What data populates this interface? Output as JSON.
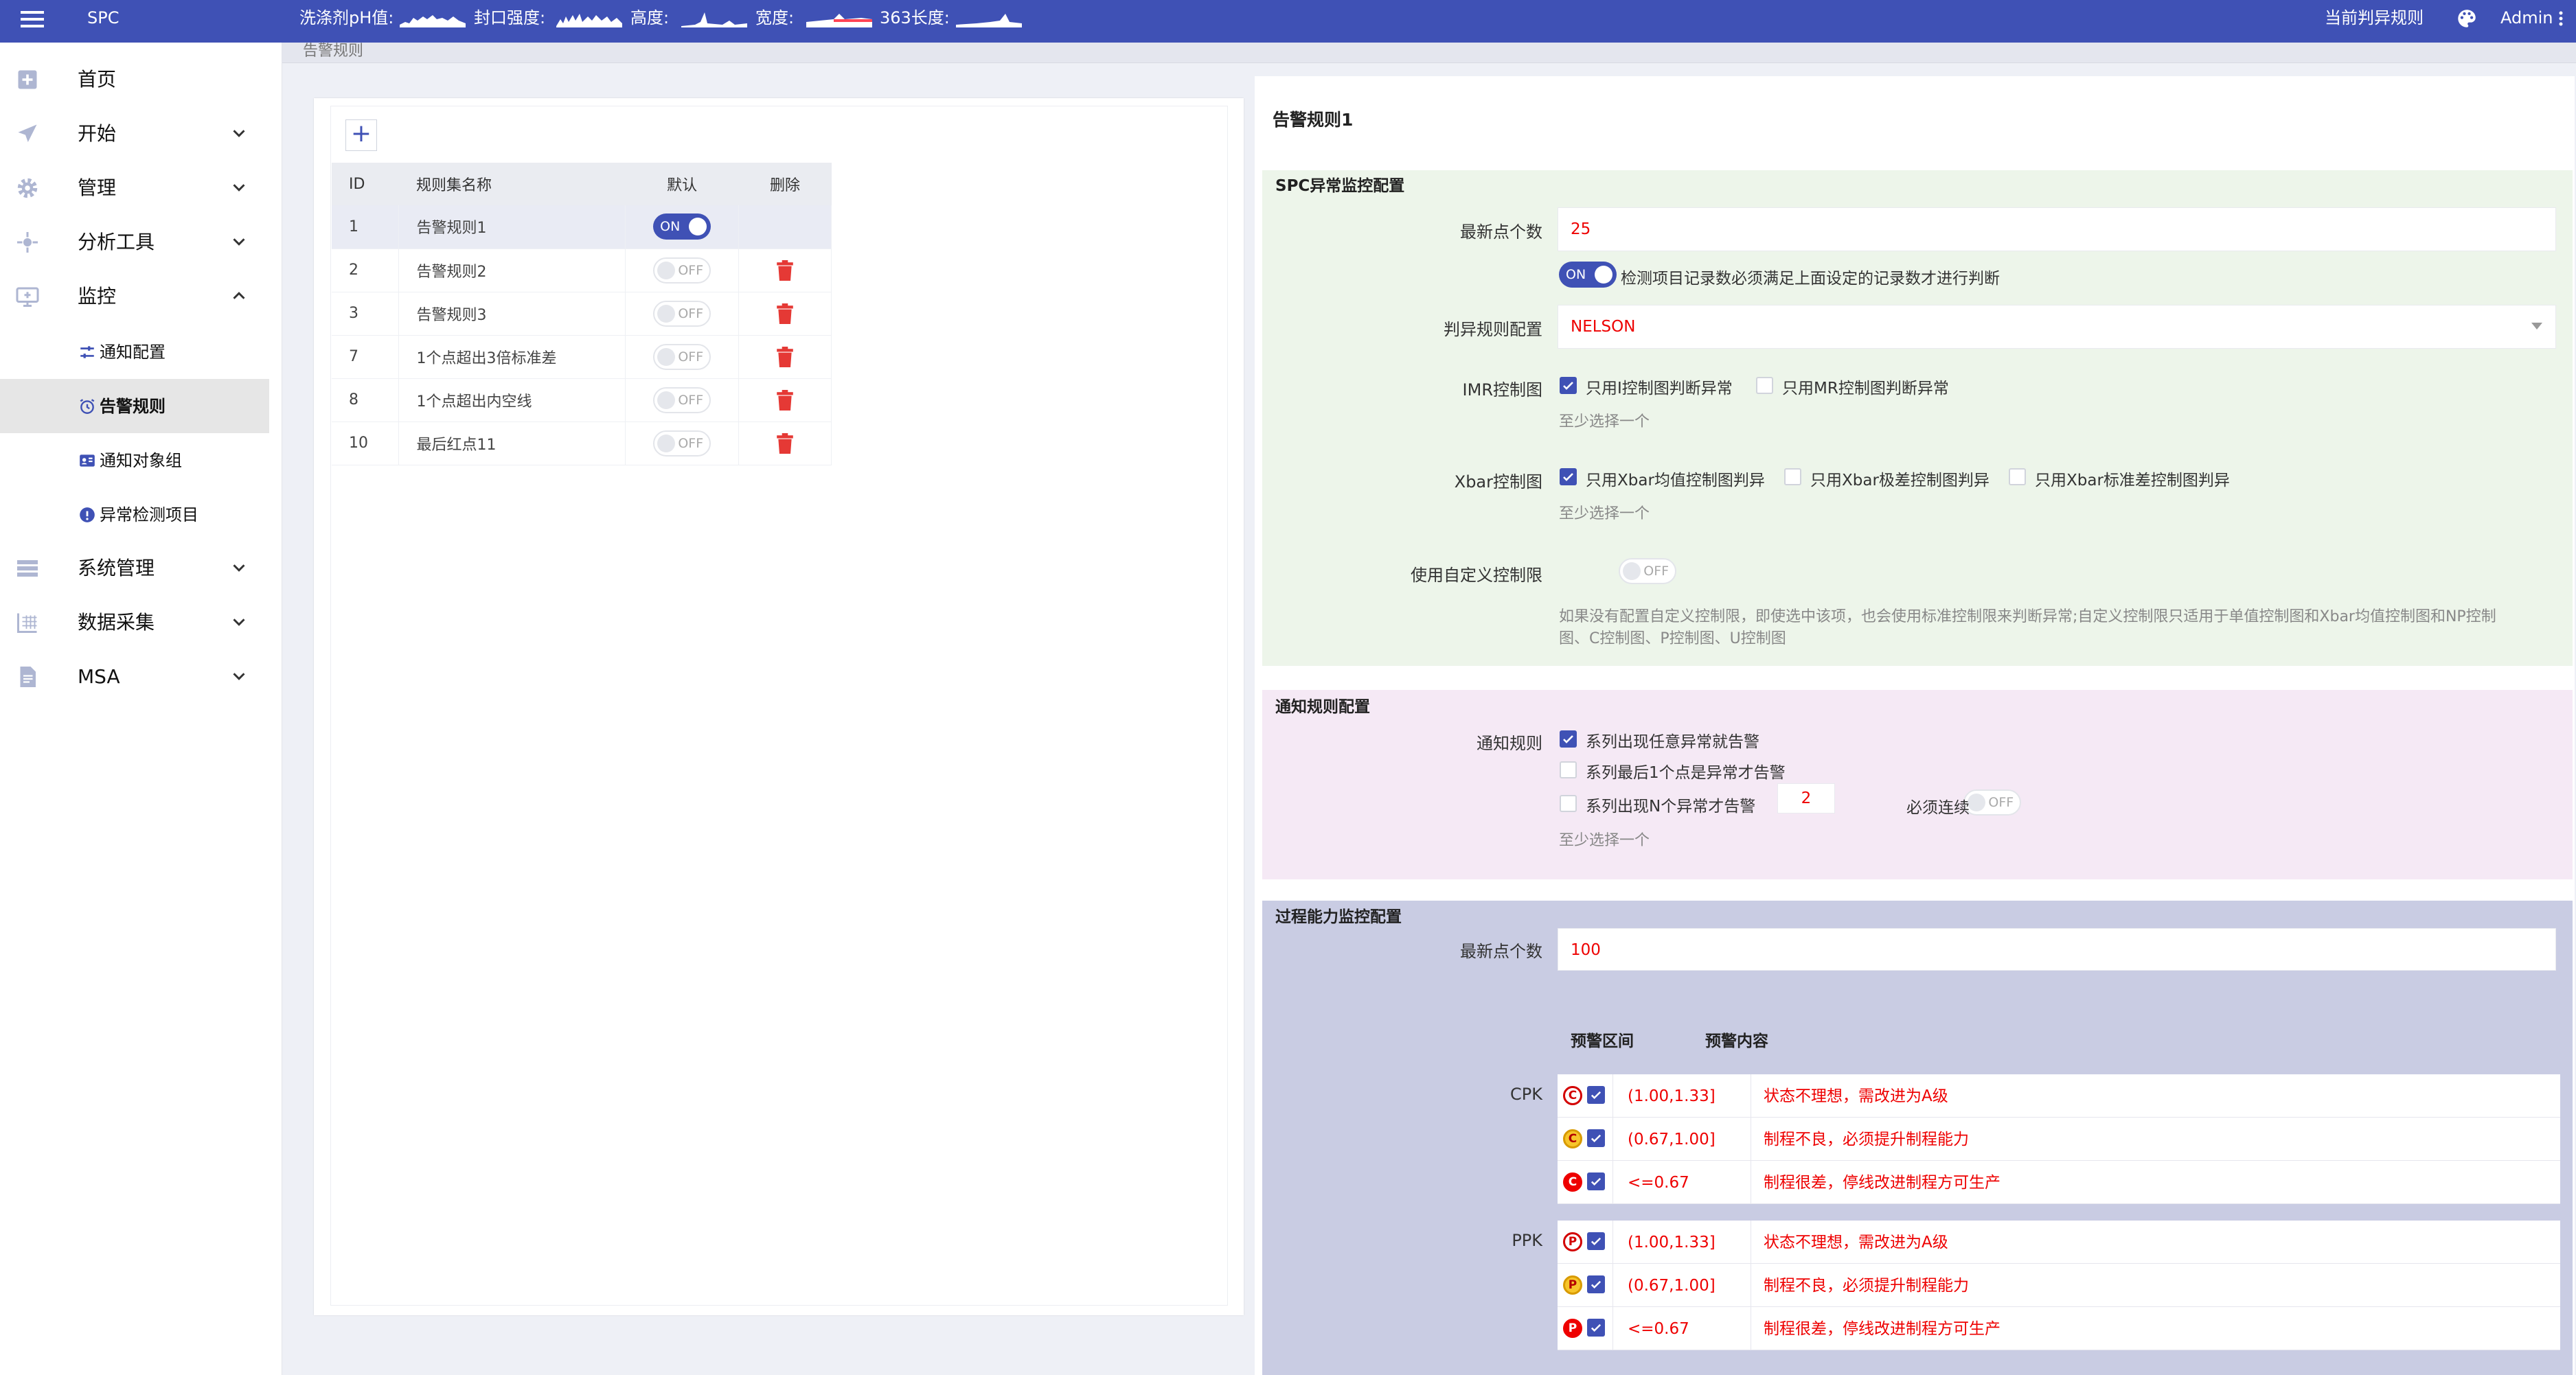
{
  "topbar": {
    "app_title": "SPC",
    "metrics": [
      "洗涤剂pH值:",
      "封口强度:",
      "高度:",
      "宽度:",
      "363长度:"
    ],
    "current_rule_link": "当前判异规则",
    "user": "Admin"
  },
  "breadcrumb": "告警规则",
  "sidebar": {
    "items": [
      {
        "label": "首页",
        "icon": "home-icon"
      },
      {
        "label": "开始",
        "icon": "send-icon",
        "expanded": false
      },
      {
        "label": "管理",
        "icon": "gear-icon",
        "expanded": false
      },
      {
        "label": "分析工具",
        "icon": "crosshair-icon",
        "expanded": false
      },
      {
        "label": "监控",
        "icon": "monitor-icon",
        "expanded": true
      },
      {
        "label": "系统管理",
        "icon": "list-icon",
        "expanded": false
      },
      {
        "label": "数据采集",
        "icon": "grid-icon",
        "expanded": false
      },
      {
        "label": "MSA",
        "icon": "document-icon",
        "expanded": false
      }
    ],
    "subitems": [
      {
        "label": "通知配置",
        "icon": "sliders-icon"
      },
      {
        "label": "告警规则",
        "icon": "alarm-clock-icon",
        "active": true
      },
      {
        "label": "通知对象组",
        "icon": "contact-card-icon"
      },
      {
        "label": "异常检测项目",
        "icon": "info-circle-icon"
      }
    ]
  },
  "rule_table": {
    "headers": [
      "ID",
      "规则集名称",
      "默认",
      "删除"
    ],
    "rows": [
      {
        "id": "1",
        "name": "告警规则1",
        "default": "ON",
        "selected": true
      },
      {
        "id": "2",
        "name": "告警规则2",
        "default": "OFF"
      },
      {
        "id": "3",
        "name": "告警规则3",
        "default": "OFF"
      },
      {
        "id": "7",
        "name": "1个点超出3倍标准差",
        "default": "OFF"
      },
      {
        "id": "8",
        "name": "1个点超出内空线",
        "default": "OFF"
      },
      {
        "id": "10",
        "name": "最后红点11",
        "default": "OFF"
      }
    ]
  },
  "detail": {
    "title": "告警规则1",
    "spc": {
      "section_title": "SPC异常监控配置",
      "latest_points_label": "最新点个数",
      "latest_points_value": "25",
      "check_toggle": "ON",
      "check_text": "检测项目记录数必须满足上面设定的记录数才进行判断",
      "rule_config_label": "判异规则配置",
      "rule_config_value": "NELSON",
      "imr_label": "IMR控制图",
      "imr_options": [
        {
          "label": "只用I控制图判断异常",
          "checked": true
        },
        {
          "label": "只用MR控制图判断异常",
          "checked": false
        }
      ],
      "imr_hint": "至少选择一个",
      "xbar_label": "Xbar控制图",
      "xbar_options": [
        {
          "label": "只用Xbar均值控制图判异",
          "checked": true
        },
        {
          "label": "只用Xbar极差控制图判异",
          "checked": false
        },
        {
          "label": "只用Xbar标准差控制图判异",
          "checked": false
        }
      ],
      "xbar_hint": "至少选择一个",
      "custom_limit_label": "使用自定义控制限",
      "custom_limit_toggle": "OFF",
      "custom_note_line1": "如果没有配置自定义控制限，即使选中该项，也会使用标准控制限来判断异常;自定义控制限只适用于单值控制图和Xbar均值控制图和NP控制",
      "custom_note_line2": "图、C控制图、P控制图、U控制图"
    },
    "notify": {
      "section_title": "通知规则配置",
      "label": "通知规则",
      "options": [
        {
          "label": "系列出现任意异常就告警",
          "checked": true
        },
        {
          "label": "系列最后1个点是异常才告警",
          "checked": false
        },
        {
          "label": "系列出现N个异常才告警",
          "checked": false
        }
      ],
      "n_value": "2",
      "consecutive_toggle": "OFF",
      "consecutive_label": "必须连续",
      "hint": "至少选择一个"
    },
    "capability": {
      "section_title": "过程能力监控配置",
      "latest_points_label": "最新点个数",
      "latest_points_value": "100",
      "col_interval": "预警区间",
      "col_content": "预警内容",
      "cpk_label": "CPK",
      "ppk_label": "PPK",
      "cpk_rows": [
        {
          "badge": "C",
          "level": "light",
          "interval": "(1.00,1.33]",
          "content": "状态不理想，需改进为A级"
        },
        {
          "badge": "C",
          "level": "yellow",
          "interval": "(0.67,1.00]",
          "content": "制程不良，必须提升制程能力"
        },
        {
          "badge": "C",
          "level": "red",
          "interval": "<=0.67",
          "content": "制程很差，停线改进制程方可生产"
        }
      ],
      "ppk_rows": [
        {
          "badge": "P",
          "level": "light",
          "interval": "(1.00,1.33]",
          "content": "状态不理想，需改进为A级"
        },
        {
          "badge": "P",
          "level": "yellow",
          "interval": "(0.67,1.00]",
          "content": "制程不良，必须提升制程能力"
        },
        {
          "badge": "P",
          "level": "red",
          "interval": "<=0.67",
          "content": "制程很差，停线改进制程方可生产"
        }
      ]
    }
  },
  "colors": {
    "primary": "#3f51b5",
    "danger": "#e53935",
    "spc_bg": "#edf5ea",
    "notify_bg": "#f5e9f5",
    "capability_bg": "#c9cce3"
  }
}
